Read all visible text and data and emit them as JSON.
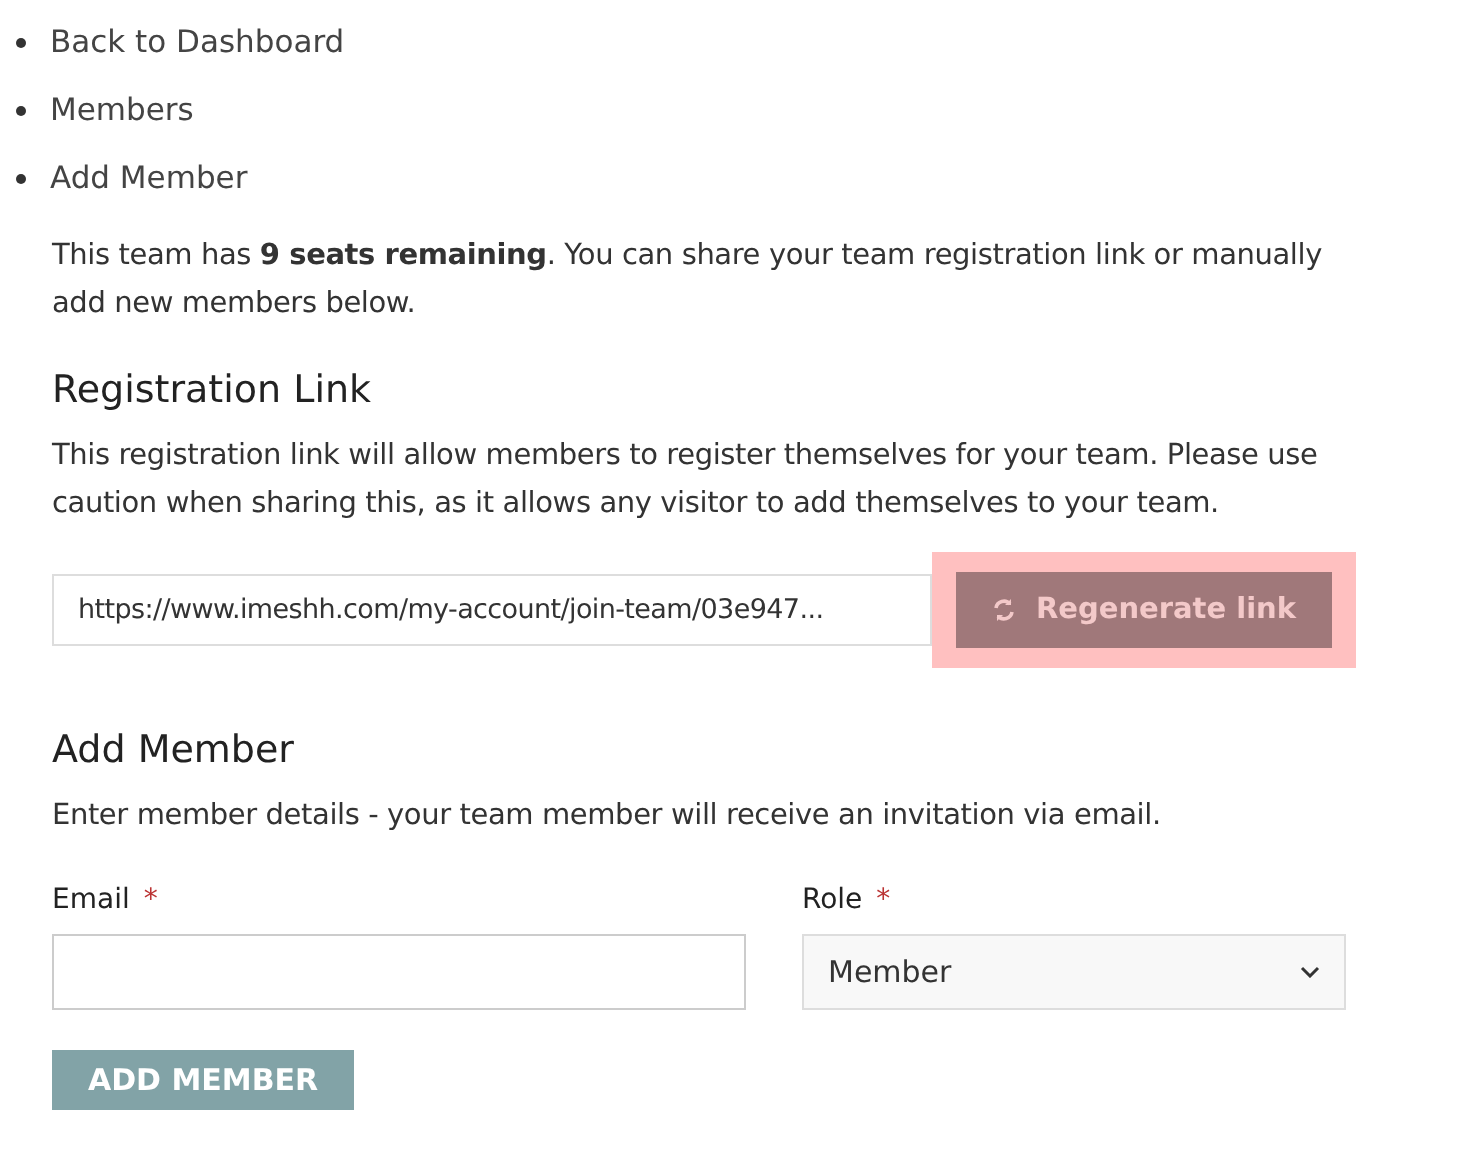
{
  "breadcrumbs": [
    {
      "label": "Back to Dashboard"
    },
    {
      "label": "Members"
    },
    {
      "label": "Add Member"
    }
  ],
  "intro": "This team has **9 seats remaining**. You can share your team registration link or manually add new members below.",
  "registration": {
    "heading": "Registration Link",
    "description": "This registration link will allow members to register themselves for your team. Please use caution when sharing this, as it allows any visitor to add themselves to your team.",
    "link_value": "https://www.imeshh.com/my-account/join-team/03e947...",
    "button": {
      "label": "Regenerate link",
      "highlighted": true
    }
  },
  "add_member": {
    "heading": "Add Member",
    "description": "Enter member details - your team member will receive an invitation via email.",
    "fields": [
      {
        "kind": "text",
        "label": "Email",
        "required_mark": "*"
      },
      {
        "kind": "select",
        "label": "Role",
        "required_mark": "*",
        "value": "Member"
      }
    ],
    "button": "ADD MEMBER"
  }
}
